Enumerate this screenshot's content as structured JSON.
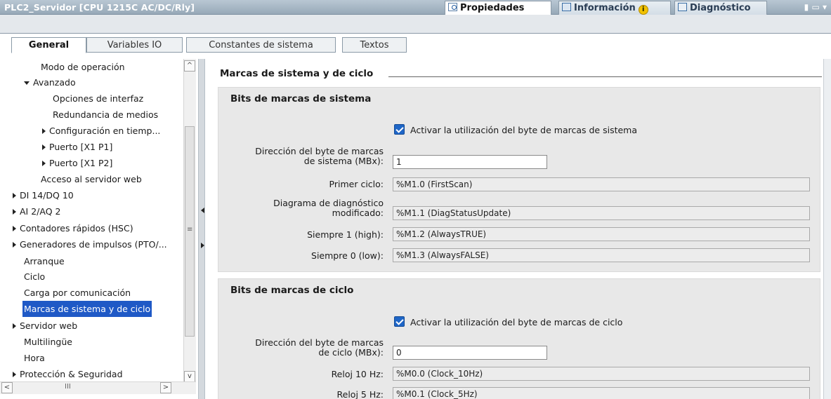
{
  "window": {
    "title": "PLC2_Servidor [CPU 1215C AC/DC/Rly]",
    "panel_tabs": [
      "Propiedades",
      "Información",
      "Diagnóstico"
    ],
    "controls": "▮ ▭ ▾"
  },
  "tabs": [
    "General",
    "Variables IO",
    "Constantes de sistema",
    "Textos"
  ],
  "tree": {
    "items": [
      "Modo de operación",
      "Avanzado",
      "Opciones de interfaz",
      "Redundancia de medios",
      "Configuración en tiemp...",
      "Puerto [X1 P1]",
      "Puerto [X1 P2]",
      "Acceso al servidor web",
      "DI 14/DQ 10",
      "AI 2/AQ 2",
      "Contadores rápidos (HSC)",
      "Generadores de impulsos (PTO/...",
      "Arranque",
      "Ciclo",
      "Carga por comunicación",
      "Marcas de sistema y de ciclo",
      "Servidor web",
      "Multilingüe",
      "Hora",
      "Protección & Seguridad"
    ],
    "selected": "Marcas de sistema y de ciclo",
    "hscroll_grip": "III"
  },
  "main": {
    "section_title": "Marcas de sistema y de ciclo",
    "system": {
      "title": "Bits de marcas de sistema",
      "enable_label": "Activar la utilización del byte de marcas de sistema",
      "enabled": true,
      "address_label_1": "Dirección del byte de marcas",
      "address_label_2": "de sistema (MBx):",
      "address_value": "1",
      "first_cycle_label": "Primer ciclo:",
      "first_cycle_value": "%M1.0 (FirstScan)",
      "diag_label_1": "Diagrama de diagnóstico",
      "diag_label_2": "modificado:",
      "diag_value": "%M1.1 (DiagStatusUpdate)",
      "always1_label": "Siempre 1 (high):",
      "always1_value": "%M1.2 (AlwaysTRUE)",
      "always0_label": "Siempre 0 (low):",
      "always0_value": "%M1.3 (AlwaysFALSE)"
    },
    "clock": {
      "title": "Bits de marcas de ciclo",
      "enable_label": "Activar la utilización del byte de marcas de ciclo",
      "enabled": true,
      "address_label_1": "Dirección del byte de marcas",
      "address_label_2": "de ciclo (MBx):",
      "address_value": "0",
      "clock10_label": "Reloj 10 Hz:",
      "clock10_value": "%M0.0 (Clock_10Hz)",
      "clock5_label": "Reloj 5 Hz:",
      "clock5_value": "%M0.1 (Clock_5Hz)"
    }
  },
  "colors": {
    "selection": "#1f59c6",
    "checkbox": "#1f66c7",
    "group_bg": "#e8e8e8"
  }
}
